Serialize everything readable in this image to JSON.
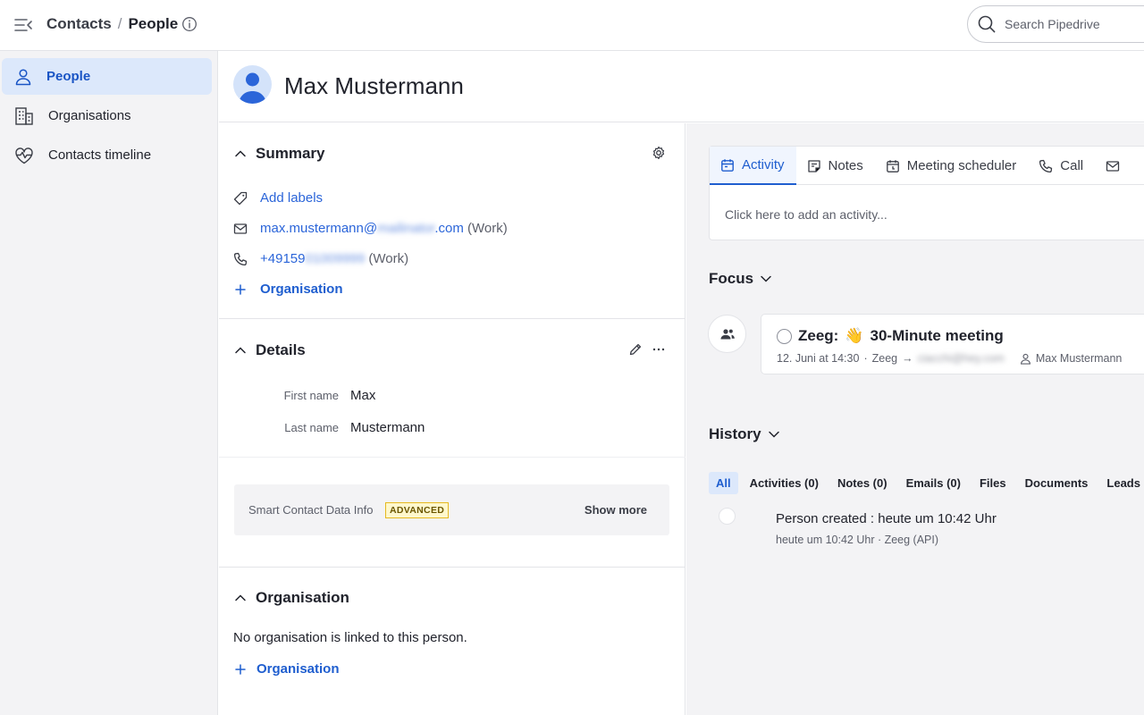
{
  "topbar": {
    "breadcrumb_parent": "Contacts",
    "breadcrumb_separator": "/",
    "breadcrumb_current": "People",
    "search_placeholder": "Search Pipedrive"
  },
  "sidebar": {
    "items": [
      {
        "label": "People",
        "icon": "person-icon",
        "active": true
      },
      {
        "label": "Organisations",
        "icon": "building-icon",
        "active": false
      },
      {
        "label": "Contacts timeline",
        "icon": "heart-pulse-icon",
        "active": false
      }
    ]
  },
  "person": {
    "name": "Max Mustermann"
  },
  "summary": {
    "title": "Summary",
    "add_labels": "Add labels",
    "email_user": "max.mustermann@",
    "email_domain_blurred": "mailinator",
    "email_tld": ".com",
    "email_type": "(Work)",
    "phone_prefix": "+49159",
    "phone_blurred": "01009999",
    "phone_type": "(Work)",
    "organisation_link": "Organisation"
  },
  "details": {
    "title": "Details",
    "first_name_label": "First name",
    "first_name_value": "Max",
    "last_name_label": "Last name",
    "last_name_value": "Mustermann",
    "smart_contact_label": "Smart Contact Data Info",
    "advanced_badge": "ADVANCED",
    "show_more": "Show more"
  },
  "organisation": {
    "title": "Organisation",
    "empty_text": "No organisation is linked to this person.",
    "add_link": "Organisation"
  },
  "composer": {
    "tabs": [
      {
        "label": "Activity",
        "icon": "calendar-icon",
        "active": true
      },
      {
        "label": "Notes",
        "icon": "note-icon",
        "active": false
      },
      {
        "label": "Meeting scheduler",
        "icon": "calendar-clock-icon",
        "active": false
      },
      {
        "label": "Call",
        "icon": "phone-icon",
        "active": false
      }
    ],
    "hint": "Click here to add an activity..."
  },
  "focus": {
    "title": "Focus",
    "activity_prefix": "Zeeg:",
    "activity_emoji": "👋",
    "activity_title": "30-Minute meeting",
    "date": "12. Juni at 14:30",
    "separator": "·",
    "owner": "Zeeg",
    "arrow": "→",
    "attendee_blurred": "ciacchi@hey.com",
    "participant": "Max Mustermann"
  },
  "history": {
    "title": "History",
    "filters": [
      {
        "label": "All",
        "active": true
      },
      {
        "label": "Activities (0)",
        "active": false
      },
      {
        "label": "Notes (0)",
        "active": false
      },
      {
        "label": "Emails (0)",
        "active": false
      },
      {
        "label": "Files",
        "active": false
      },
      {
        "label": "Documents",
        "active": false
      },
      {
        "label": "Leads",
        "active": false
      }
    ],
    "entry_title": "Person created : heute um 10:42 Uhr",
    "entry_meta": "heute um 10:42 Uhr · Zeeg (API)"
  },
  "colors": {
    "accent": "#1f5ecf",
    "active_bg": "#dce8fb",
    "panel_bg": "#f3f3f5",
    "badge_border": "#e6b91e",
    "badge_bg": "#fff8cc"
  }
}
